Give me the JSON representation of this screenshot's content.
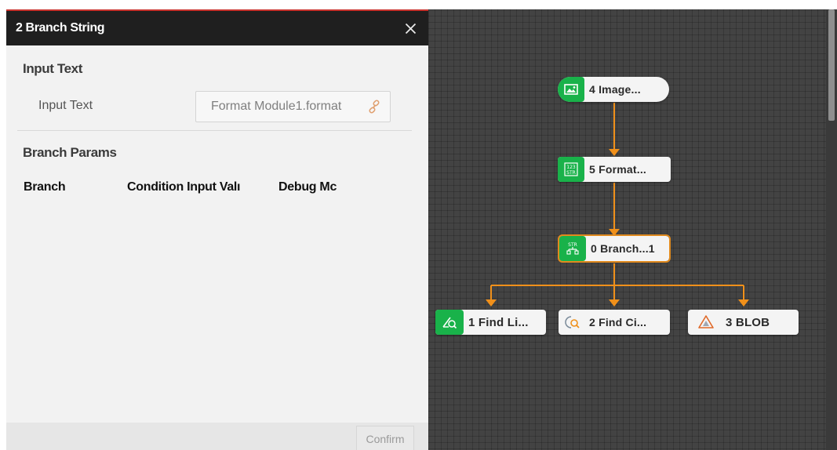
{
  "dialog": {
    "title": "2 Branch String",
    "close_icon": "close-icon",
    "input_section": {
      "title": "Input Text",
      "field_label": "Input Text",
      "field_value": "Format Module1.format",
      "link_icon": "link-icon"
    },
    "branch_section": {
      "title": "Branch Params",
      "columns": [
        "Branch",
        "Condition Input Valı",
        "Debug Mc"
      ]
    },
    "footer": {
      "confirm_label": "Confirm"
    }
  },
  "canvas": {
    "nodes": [
      {
        "id": "image",
        "label": "4 Image...",
        "icon": "image-icon",
        "icon_style": "green"
      },
      {
        "id": "format",
        "label": "5 Format...",
        "icon": "format-str-icon",
        "icon_style": "green"
      },
      {
        "id": "branch",
        "label": "0 Branch...1",
        "icon": "branch-str-icon",
        "icon_style": "green",
        "selected": true
      },
      {
        "id": "find-line",
        "label": "1 Find Li...",
        "icon": "find-line-icon",
        "icon_style": "green"
      },
      {
        "id": "find-circle",
        "label": "2 Find Ci...",
        "icon": "find-circle-icon",
        "icon_style": "plain"
      },
      {
        "id": "blob",
        "label": "3 BLOB",
        "icon": "blob-icon",
        "icon_style": "plain"
      }
    ],
    "connector_color": "#f0901a",
    "node_icon_green": "#19b24a"
  }
}
